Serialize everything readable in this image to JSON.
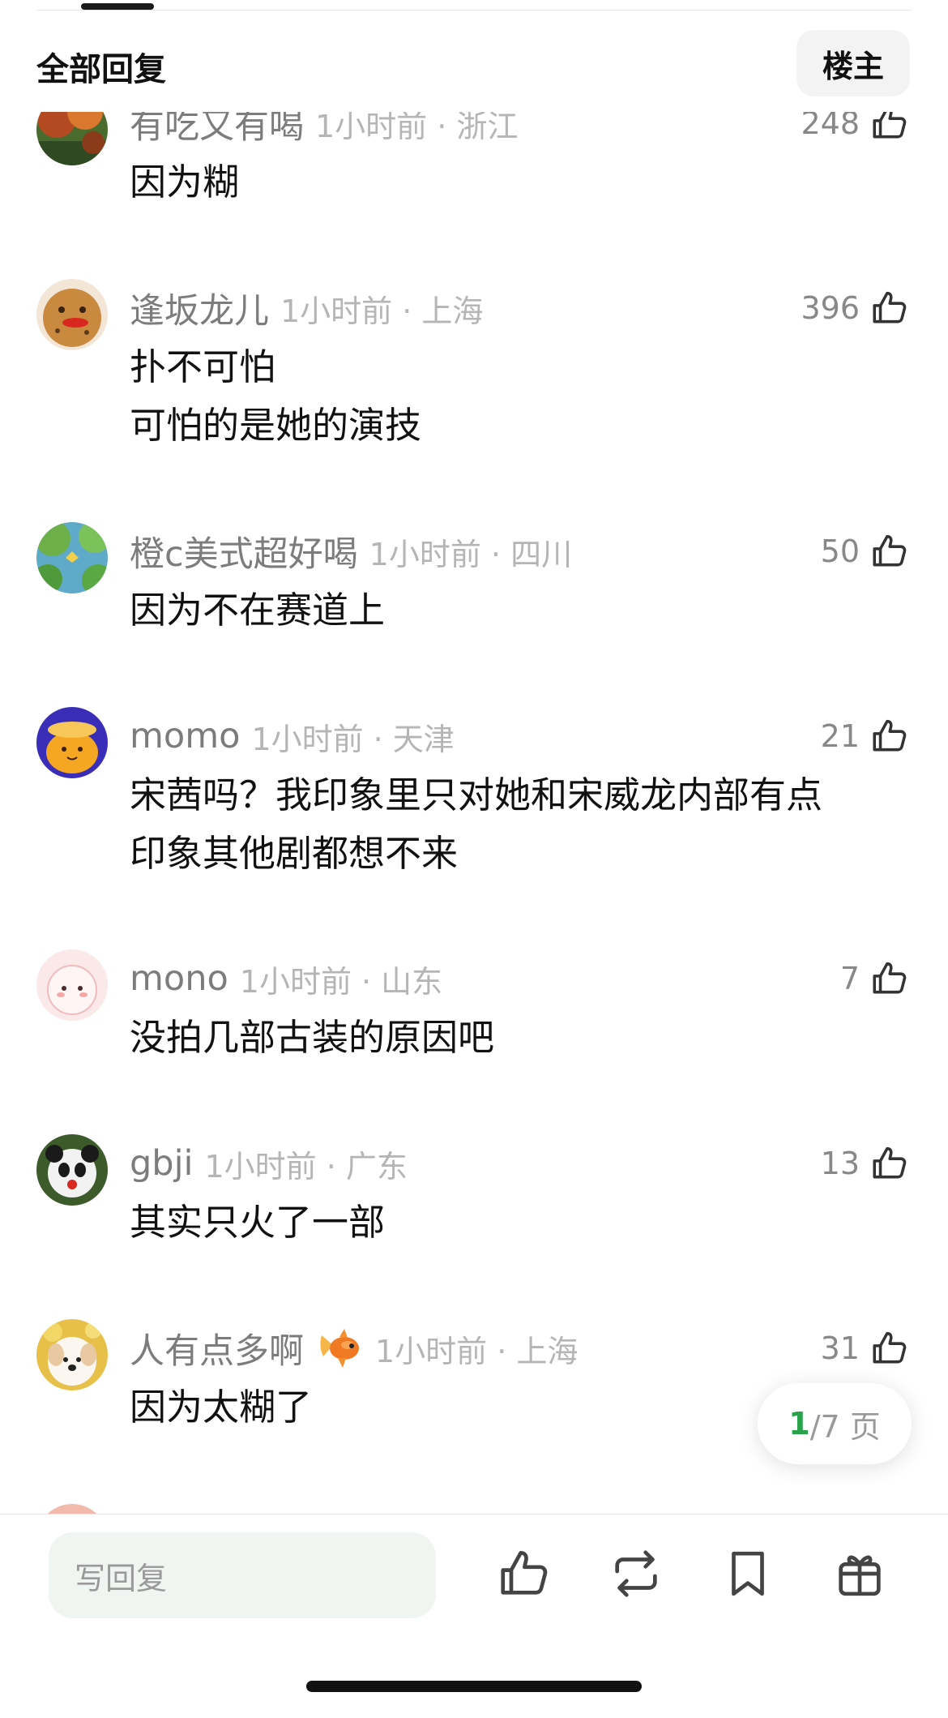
{
  "header": {
    "title": "全部回复",
    "owner_button": "楼主"
  },
  "comments": [
    {
      "username": "有吃又有喝",
      "time": "1小时前 · 浙江",
      "likes": "248",
      "lines": [
        "因为糊"
      ]
    },
    {
      "username": "逢坂龙儿",
      "time": "1小时前 · 上海",
      "likes": "396",
      "lines": [
        "扑不可怕",
        "可怕的是她的演技"
      ]
    },
    {
      "username": "橙c美式超好喝",
      "time": "1小时前 · 四川",
      "likes": "50",
      "lines": [
        "因为不在赛道上"
      ]
    },
    {
      "username": "momo",
      "time": "1小时前 · 天津",
      "likes": "21",
      "lines": [
        "宋茜吗？我印象里只对她和宋威龙内部有点",
        "印象其他剧都想不来"
      ]
    },
    {
      "username": "mono",
      "time": "1小时前 · 山东",
      "likes": "7",
      "lines": [
        "没拍几部古装的原因吧"
      ]
    },
    {
      "username": "gbji",
      "time": "1小时前 · 广东",
      "likes": "13",
      "lines": [
        "其实只火了一部"
      ]
    },
    {
      "username": "人有点多啊",
      "badge": "goldfish-emoji",
      "time": "1小时前 · 上海",
      "likes": "31",
      "lines": [
        "因为太糊了"
      ]
    }
  ],
  "pager": {
    "current": "1",
    "total_text": "/7 页"
  },
  "bottom_bar": {
    "reply_placeholder": "写回复",
    "icons": [
      "like-icon",
      "repost-icon",
      "bookmark-icon",
      "gift-icon"
    ]
  },
  "colors": {
    "accent_green": "#27a34a",
    "username_gray": "#7c7c7c",
    "meta_gray": "#b5b5b5",
    "reply_bg": "#f0f5f1"
  }
}
